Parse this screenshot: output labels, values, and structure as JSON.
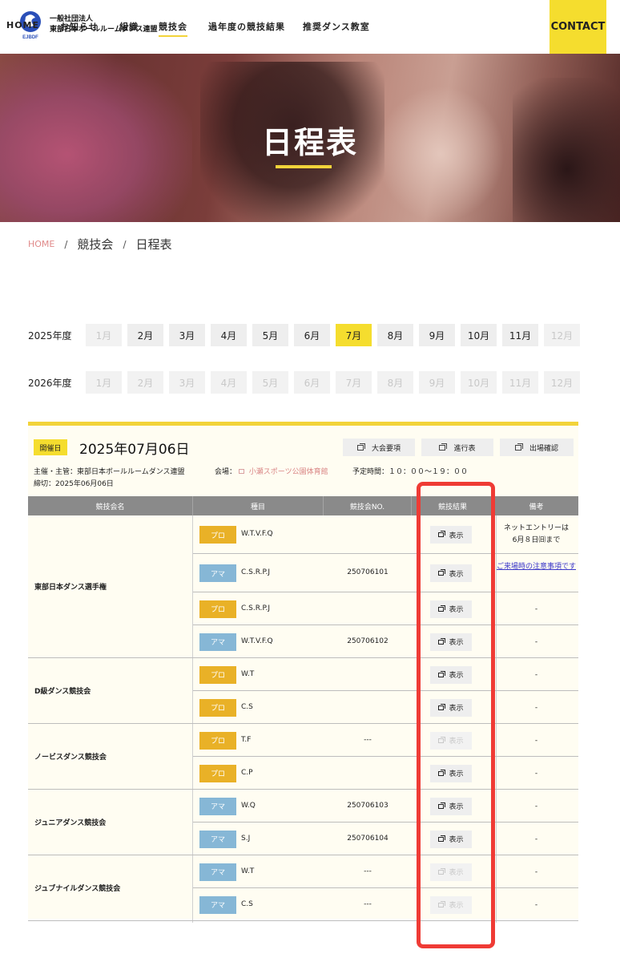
{
  "header": {
    "logo_text": "EJBDF",
    "org_line1": "一般社団法人",
    "org_line2": "東部日本ボールルームダンス連盟",
    "nav": [
      "HOME",
      "お知らせ",
      "組織",
      "競技会",
      "過年度の競技結果",
      "推奨ダンス教室"
    ],
    "nav_active": "競技会",
    "contact": "CONTACT",
    "accent_color": "#f5dd2e"
  },
  "hero": {
    "title": "日程表"
  },
  "breadcrumb": {
    "home": "HOME",
    "sep": "/",
    "item1": "競技会",
    "item2": "日程表"
  },
  "years": [
    {
      "label": "2025年度",
      "months": [
        {
          "label": "1月",
          "state": "disabled"
        },
        {
          "label": "2月",
          "state": "normal"
        },
        {
          "label": "3月",
          "state": "normal"
        },
        {
          "label": "4月",
          "state": "normal"
        },
        {
          "label": "5月",
          "state": "normal"
        },
        {
          "label": "6月",
          "state": "normal"
        },
        {
          "label": "7月",
          "state": "active"
        },
        {
          "label": "8月",
          "state": "normal"
        },
        {
          "label": "9月",
          "state": "normal"
        },
        {
          "label": "10月",
          "state": "normal"
        },
        {
          "label": "11月",
          "state": "normal"
        },
        {
          "label": "12月",
          "state": "disabled"
        }
      ]
    },
    {
      "label": "2026年度",
      "months": [
        {
          "label": "1月",
          "state": "disabled"
        },
        {
          "label": "2月",
          "state": "disabled"
        },
        {
          "label": "3月",
          "state": "disabled"
        },
        {
          "label": "4月",
          "state": "disabled"
        },
        {
          "label": "5月",
          "state": "disabled"
        },
        {
          "label": "6月",
          "state": "disabled"
        },
        {
          "label": "7月",
          "state": "disabled"
        },
        {
          "label": "8月",
          "state": "disabled"
        },
        {
          "label": "9月",
          "state": "disabled"
        },
        {
          "label": "10月",
          "state": "disabled"
        },
        {
          "label": "11月",
          "state": "disabled"
        },
        {
          "label": "12月",
          "state": "disabled"
        }
      ]
    }
  ],
  "event": {
    "badge": "開催日",
    "date": "2025年07月06日",
    "buttons": {
      "guidelines": "大会要項",
      "schedule": "進行表",
      "entry_check": "出場確認"
    },
    "organizer": "主催・主管：東部日本ボールルームダンス連盟",
    "venue_label": "会場：",
    "venue": "小瀬スポーツ公園体育館",
    "time": "予定時間：１０：００〜１９：００",
    "deadline": "締切：2025年06月06日"
  },
  "table": {
    "headers": [
      "競技会名",
      "種目",
      "競技会NO.",
      "競技結果",
      "備考"
    ],
    "groups": [
      {
        "name": "東部日本ダンス選手権",
        "rows": 4
      },
      {
        "name": "D級ダンス競技会",
        "rows": 2
      },
      {
        "name": "ノービスダンス競技会",
        "rows": 2
      },
      {
        "name": "ジュニアダンス競技会",
        "rows": 2
      },
      {
        "name": "ジュブナイルダンス競技会",
        "rows": 2
      }
    ],
    "rows": [
      {
        "tag": "プロ",
        "type": "pro",
        "kind": "W.T.V.F.Q",
        "num": "",
        "result": "表示",
        "result_enabled": true,
        "note": "ネットエントリーは\n6月８日㈰まで",
        "note_link": false
      },
      {
        "tag": "アマ",
        "type": "ama",
        "kind": "C.S.R.P.J",
        "num": "250706101",
        "result": "表示",
        "result_enabled": true,
        "note": "ご来場時の注意事項です",
        "note_link": true
      },
      {
        "tag": "プロ",
        "type": "pro",
        "kind": "C.S.R.P.J",
        "num": "",
        "result": "表示",
        "result_enabled": true,
        "note": "-",
        "note_link": false
      },
      {
        "tag": "アマ",
        "type": "ama",
        "kind": "W.T.V.F.Q",
        "num": "250706102",
        "result": "表示",
        "result_enabled": true,
        "note": "-",
        "note_link": false
      },
      {
        "tag": "プロ",
        "type": "pro",
        "kind": "W.T",
        "num": "",
        "result": "表示",
        "result_enabled": true,
        "note": "-",
        "note_link": false
      },
      {
        "tag": "プロ",
        "type": "pro",
        "kind": "C.S",
        "num": "",
        "result": "表示",
        "result_enabled": true,
        "note": "-",
        "note_link": false
      },
      {
        "tag": "プロ",
        "type": "pro",
        "kind": "T.F",
        "num": "---",
        "result": "表示",
        "result_enabled": false,
        "note": "-",
        "note_link": false
      },
      {
        "tag": "プロ",
        "type": "pro",
        "kind": "C.P",
        "num": "",
        "result": "表示",
        "result_enabled": true,
        "note": "-",
        "note_link": false
      },
      {
        "tag": "アマ",
        "type": "ama",
        "kind": "W.Q",
        "num": "250706103",
        "result": "表示",
        "result_enabled": true,
        "note": "-",
        "note_link": false
      },
      {
        "tag": "アマ",
        "type": "ama",
        "kind": "S.J",
        "num": "250706104",
        "result": "表示",
        "result_enabled": true,
        "note": "-",
        "note_link": false
      },
      {
        "tag": "アマ",
        "type": "ama",
        "kind": "W.T",
        "num": "---",
        "result": "表示",
        "result_enabled": false,
        "note": "-",
        "note_link": false
      },
      {
        "tag": "アマ",
        "type": "ama",
        "kind": "C.S",
        "num": "---",
        "result": "表示",
        "result_enabled": false,
        "note": "-",
        "note_link": false
      }
    ]
  },
  "colors": {
    "pro": "#e9b127",
    "ama": "#86b7d6",
    "highlight": "#ef3b35",
    "header_gray": "#8a8a8a"
  }
}
